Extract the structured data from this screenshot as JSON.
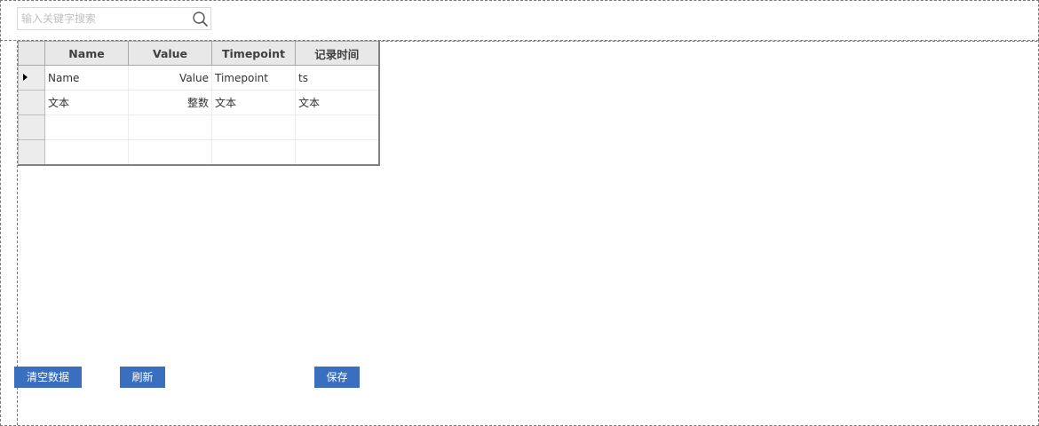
{
  "search": {
    "placeholder": "输入关键字搜索",
    "value": ""
  },
  "grid": {
    "columns": [
      "Name",
      "Value",
      "Timepoint",
      "记录时间"
    ],
    "rows": [
      [
        "Name",
        "Value",
        "Timepoint",
        "ts"
      ],
      [
        "文本",
        "整数",
        "文本",
        "文本"
      ],
      [
        "",
        "",
        "",
        ""
      ],
      [
        "",
        "",
        "",
        ""
      ]
    ],
    "current_row": 1
  },
  "buttons": {
    "clear": "清空数据",
    "refresh": "刷新",
    "save": "保存"
  },
  "colors": {
    "button_bg": "#3a6fbf",
    "button_text": "#ffffff",
    "header_bg": "#e8e8e8",
    "border_dashed": "#7a7a7a"
  }
}
